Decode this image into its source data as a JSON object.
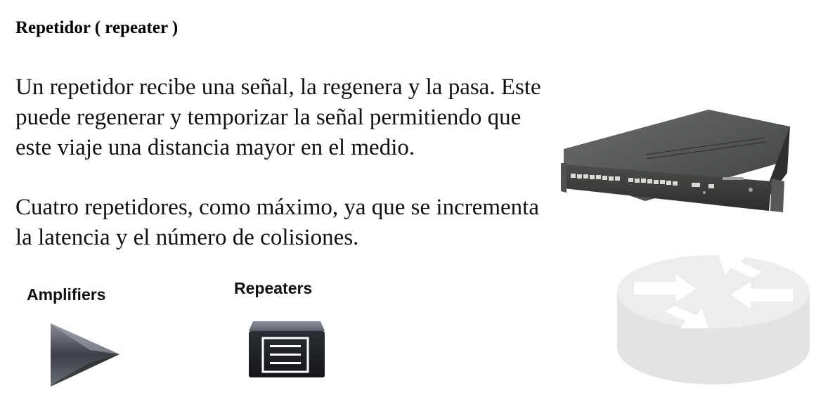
{
  "slide": {
    "title": "Repetidor ( repeater )",
    "paragraph1": [
      "Un repetidor recibe una señal, la regenera y la pasa. Este",
      "puede regenerar y temporizar la señal  permitiendo que",
      "este viaje una distancia mayor en el medio."
    ],
    "paragraph2": [
      "Cuatro repetidores, como máximo, ya que se incrementa",
      "la latencia y el número de colisiones."
    ]
  },
  "icons": {
    "amplifiers_label": "Amplifiers",
    "repeaters_label": "Repeaters",
    "amplifier_icon": "amplifier-triangle-icon",
    "repeater_icon": "repeater-box-icon",
    "router_icon": "router-icon",
    "photo": "network-repeater-device-photo"
  }
}
